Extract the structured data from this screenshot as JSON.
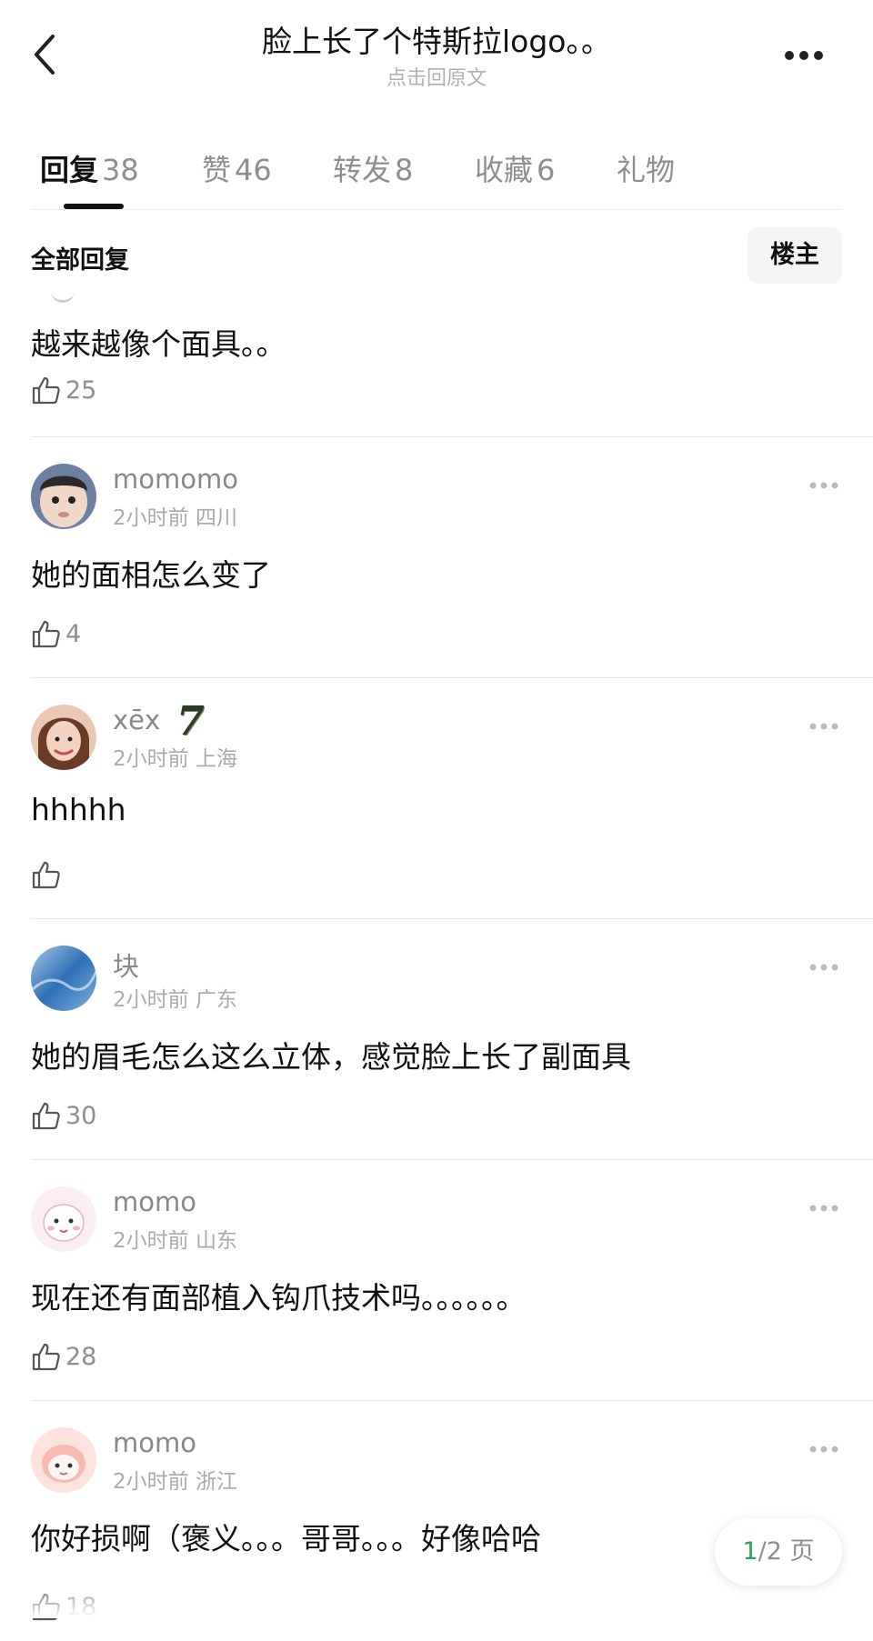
{
  "header": {
    "title": "脸上长了个特斯拉logo。。",
    "subtitle": "点击回原文"
  },
  "tabs": [
    {
      "label": "回复",
      "count": "38"
    },
    {
      "label": "赞",
      "count": "46"
    },
    {
      "label": "转发",
      "count": "8"
    },
    {
      "label": "收藏",
      "count": "6"
    },
    {
      "label": "礼物",
      "count": ""
    }
  ],
  "filter": {
    "all_label": "全部回复",
    "owner_label": "楼主"
  },
  "first_comment": {
    "text": "越来越像个面具。。",
    "likes": "25"
  },
  "comments": [
    {
      "username": "momomo",
      "time": "2小时前",
      "location": "四川",
      "text": "她的面相怎么变了",
      "likes": "4"
    },
    {
      "username": "xēx",
      "badge": "7",
      "time": "2小时前",
      "location": "上海",
      "text": "hhhhh",
      "likes": ""
    },
    {
      "username": "块",
      "time": "2小时前",
      "location": "广东",
      "text": "她的眉毛怎么这么立体，感觉脸上长了副面具",
      "likes": "30"
    },
    {
      "username": "momo",
      "time": "2小时前",
      "location": "山东",
      "text": "现在还有面部植入钩爪技术吗。。。。。。",
      "likes": "28"
    },
    {
      "username": "momo",
      "time": "2小时前",
      "location": "浙江",
      "text": "你好损啊（褒义。。。哥哥。。。好像哈哈",
      "likes": "18"
    }
  ],
  "pager": {
    "current": "1",
    "total": "/2 页"
  }
}
